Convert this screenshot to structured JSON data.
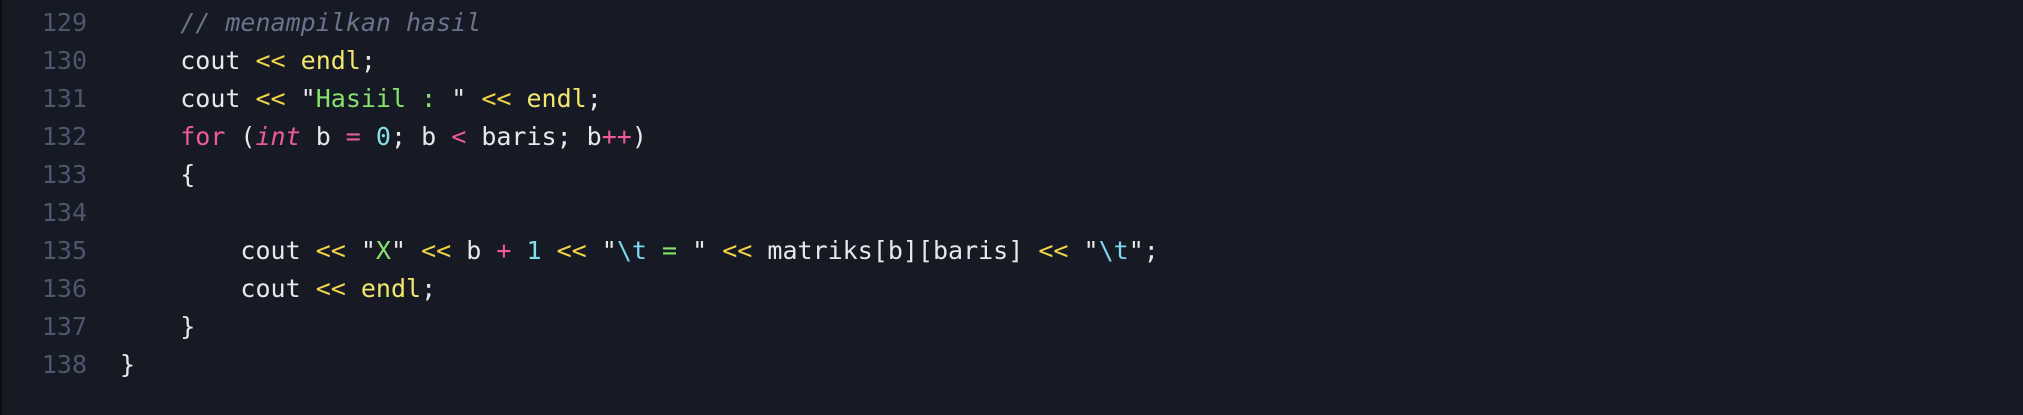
{
  "editor": {
    "language": "cpp",
    "theme_colors": {
      "background": "#161a24",
      "line_number": "#4e566a",
      "comment": "#6c7386",
      "text": "#e8e8ea",
      "operator": "#f5d547",
      "function": "#f5e66b",
      "string": "#86e36b",
      "keyword": "#ee5a9b",
      "number": "#7fe3e8",
      "escape": "#7fd7f0"
    },
    "lines": [
      {
        "number": "129",
        "indent": "    ",
        "tokens": [
          {
            "type": "comment",
            "text": "// menampilkan hasil"
          }
        ]
      },
      {
        "number": "130",
        "indent": "    ",
        "tokens": [
          {
            "type": "plain",
            "text": "cout "
          },
          {
            "type": "op",
            "text": "<<"
          },
          {
            "type": "plain",
            "text": " "
          },
          {
            "type": "func",
            "text": "endl"
          },
          {
            "type": "plain",
            "text": ";"
          }
        ]
      },
      {
        "number": "131",
        "indent": "    ",
        "tokens": [
          {
            "type": "plain",
            "text": "cout "
          },
          {
            "type": "op",
            "text": "<<"
          },
          {
            "type": "plain",
            "text": " "
          },
          {
            "type": "quote",
            "text": "\""
          },
          {
            "type": "string",
            "text": "Hasiil : "
          },
          {
            "type": "quote",
            "text": "\""
          },
          {
            "type": "plain",
            "text": " "
          },
          {
            "type": "op",
            "text": "<<"
          },
          {
            "type": "plain",
            "text": " "
          },
          {
            "type": "func",
            "text": "endl"
          },
          {
            "type": "plain",
            "text": ";"
          }
        ]
      },
      {
        "number": "132",
        "indent": "    ",
        "tokens": [
          {
            "type": "keyword",
            "text": "for"
          },
          {
            "type": "plain",
            "text": " ("
          },
          {
            "type": "type",
            "text": "int"
          },
          {
            "type": "plain",
            "text": " b "
          },
          {
            "type": "pinkop",
            "text": "="
          },
          {
            "type": "plain",
            "text": " "
          },
          {
            "type": "number",
            "text": "0"
          },
          {
            "type": "plain",
            "text": "; b "
          },
          {
            "type": "pinkop",
            "text": "<"
          },
          {
            "type": "plain",
            "text": " baris; b"
          },
          {
            "type": "pinkop",
            "text": "++"
          },
          {
            "type": "plain",
            "text": ")"
          }
        ]
      },
      {
        "number": "133",
        "indent": "    ",
        "tokens": [
          {
            "type": "plain",
            "text": "{"
          }
        ]
      },
      {
        "number": "134",
        "indent": "",
        "tokens": []
      },
      {
        "number": "135",
        "indent": "        ",
        "tokens": [
          {
            "type": "plain",
            "text": "cout "
          },
          {
            "type": "op",
            "text": "<<"
          },
          {
            "type": "plain",
            "text": " "
          },
          {
            "type": "quote",
            "text": "\""
          },
          {
            "type": "string",
            "text": "X"
          },
          {
            "type": "quote",
            "text": "\""
          },
          {
            "type": "plain",
            "text": " "
          },
          {
            "type": "op",
            "text": "<<"
          },
          {
            "type": "plain",
            "text": " b "
          },
          {
            "type": "pinkop",
            "text": "+"
          },
          {
            "type": "plain",
            "text": " "
          },
          {
            "type": "number",
            "text": "1"
          },
          {
            "type": "plain",
            "text": " "
          },
          {
            "type": "op",
            "text": "<<"
          },
          {
            "type": "plain",
            "text": " "
          },
          {
            "type": "quote",
            "text": "\""
          },
          {
            "type": "escape",
            "text": "\\t"
          },
          {
            "type": "string",
            "text": " = "
          },
          {
            "type": "quote",
            "text": "\""
          },
          {
            "type": "plain",
            "text": " "
          },
          {
            "type": "op",
            "text": "<<"
          },
          {
            "type": "plain",
            "text": " matriks[b][baris] "
          },
          {
            "type": "op",
            "text": "<<"
          },
          {
            "type": "plain",
            "text": " "
          },
          {
            "type": "quote",
            "text": "\""
          },
          {
            "type": "escape",
            "text": "\\t"
          },
          {
            "type": "quote",
            "text": "\""
          },
          {
            "type": "plain",
            "text": ";"
          }
        ]
      },
      {
        "number": "136",
        "indent": "        ",
        "tokens": [
          {
            "type": "plain",
            "text": "cout "
          },
          {
            "type": "op",
            "text": "<<"
          },
          {
            "type": "plain",
            "text": " "
          },
          {
            "type": "func",
            "text": "endl"
          },
          {
            "type": "plain",
            "text": ";"
          }
        ]
      },
      {
        "number": "137",
        "indent": "    ",
        "tokens": [
          {
            "type": "plain",
            "text": "}"
          }
        ]
      },
      {
        "number": "138",
        "indent": "",
        "tokens": [
          {
            "type": "plain",
            "text": "}"
          }
        ]
      }
    ]
  }
}
